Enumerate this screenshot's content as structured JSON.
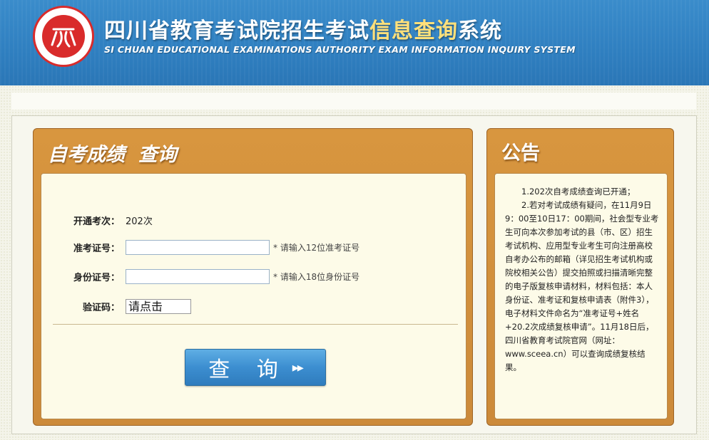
{
  "header": {
    "title_part1": "四川省教育考试院招生考试",
    "title_highlight": "信息查询",
    "title_part2": "系统",
    "subtitle": "SI CHUAN EDUCATIONAL EXAMINATIONS AUTHORITY EXAM INFORMATION INQUIRY SYSTEM",
    "accent_color": "#ffe07a"
  },
  "query_panel": {
    "title": "自考成绩  查询",
    "exam_session_label": "开通考次：",
    "exam_session_value": "202次",
    "ticket_label": "准考证号：",
    "ticket_value": "",
    "ticket_hint": "* 请输入12位准考证号",
    "id_label": "身份证号：",
    "id_value": "",
    "id_hint": "* 请输入18位身份证号",
    "captcha_label": "验证码：",
    "captcha_text": "请点击",
    "query_button_label": "查 询",
    "query_button_icon": "double-chevron-right-icon"
  },
  "notice_panel": {
    "title": "公告",
    "paragraphs": [
      "1.202次自考成绩查询已开通；",
      "2.若对考试成绩有疑问，在11月9日9：00至10日17：00期间，社会型专业考生可向本次参加考试的县（市、区）招生考试机构、应用型专业考生可向注册高校自考办公布的邮箱（详见招生考试机构或院校相关公告）提交拍照或扫描清晰完整的电子版复核申请材料，材料包括：本人身份证、准考证和复核申请表（附件3），电子材料文件命名为“准考证号+姓名+20.2次成绩复核申请”。11月18日后，四川省教育考试院官网（网址：www.sceea.cn）可以查询成绩复核结果。"
    ]
  }
}
